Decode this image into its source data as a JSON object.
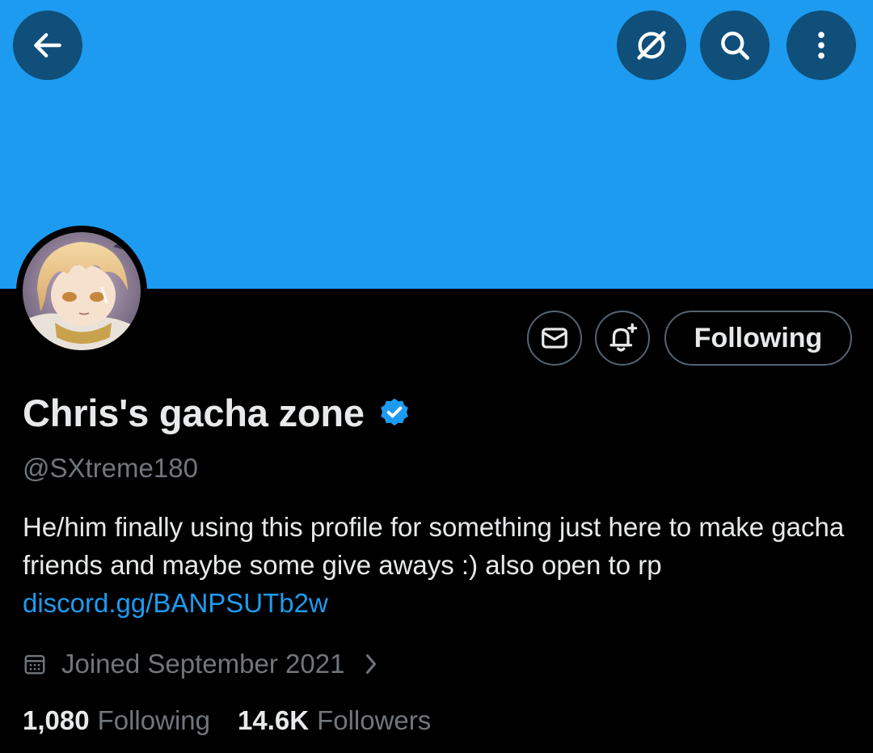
{
  "header": {
    "back_icon": "arrow-left-icon",
    "grok_icon": "grok-icon",
    "search_icon": "search-icon",
    "more_icon": "more-vertical-icon",
    "banner_color": "#1d9bf0",
    "button_color": "#0f4f7a"
  },
  "profile": {
    "display_name": "Chris's gacha zone",
    "verified": true,
    "handle": "@SXtreme180",
    "bio_text": "He/him finally using this profile for something just here to make gacha friends and maybe some give aways :) also open to rp ",
    "bio_link": "discord.gg/BANPSUTb2w",
    "joined": "Joined September 2021",
    "following_count": "1,080",
    "following_label": "Following",
    "followers_count": "14.6K",
    "followers_label": "Followers"
  },
  "actions": {
    "message_icon": "envelope-icon",
    "notify_icon": "bell-plus-icon",
    "follow_label": "Following"
  },
  "colors": {
    "accent": "#1d9bf0",
    "text_primary": "#e7e9ea",
    "text_secondary": "#71767b",
    "border": "#536471"
  }
}
